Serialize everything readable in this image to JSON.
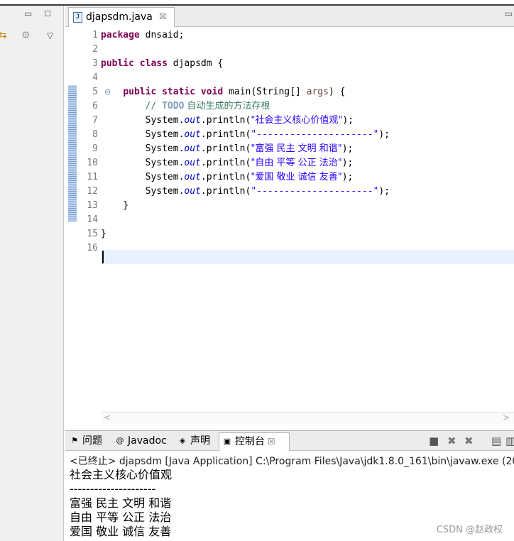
{
  "editor": {
    "tab_label": "djapsdm.java",
    "lines": [
      {
        "n": "1",
        "segs": [
          {
            "c": "kw",
            "t": "package"
          },
          {
            "c": "",
            "t": " dnsaid;"
          }
        ]
      },
      {
        "n": "2",
        "segs": []
      },
      {
        "n": "3",
        "segs": [
          {
            "c": "kw",
            "t": "public"
          },
          {
            "c": "",
            "t": " "
          },
          {
            "c": "kw",
            "t": "class"
          },
          {
            "c": "",
            "t": " djapsdm {"
          }
        ]
      },
      {
        "n": "4",
        "segs": []
      },
      {
        "n": "5",
        "segs": [
          {
            "c": "",
            "t": "    "
          },
          {
            "c": "kw",
            "t": "public"
          },
          {
            "c": "",
            "t": " "
          },
          {
            "c": "kw",
            "t": "static"
          },
          {
            "c": "",
            "t": " "
          },
          {
            "c": "kw",
            "t": "void"
          },
          {
            "c": "",
            "t": " main(String[] "
          },
          {
            "c": "param",
            "t": "args"
          },
          {
            "c": "",
            "t": ") {"
          }
        ]
      },
      {
        "n": "6",
        "segs": [
          {
            "c": "",
            "t": "        "
          },
          {
            "c": "cm",
            "t": "// "
          },
          {
            "c": "todo",
            "t": "TODO"
          },
          {
            "c": "cm cjk",
            "t": " 自动生成的方法存根"
          }
        ]
      },
      {
        "n": "7",
        "segs": [
          {
            "c": "",
            "t": "        System."
          },
          {
            "c": "fld",
            "t": "out"
          },
          {
            "c": "",
            "t": ".println("
          },
          {
            "c": "str cjk",
            "t": "\"社会主义核心价值观\""
          },
          {
            "c": "",
            "t": ");"
          }
        ]
      },
      {
        "n": "8",
        "segs": [
          {
            "c": "",
            "t": "        System."
          },
          {
            "c": "fld",
            "t": "out"
          },
          {
            "c": "",
            "t": ".println("
          },
          {
            "c": "str",
            "t": "\"---------------------\""
          },
          {
            "c": "",
            "t": ");"
          }
        ]
      },
      {
        "n": "9",
        "segs": [
          {
            "c": "",
            "t": "        System."
          },
          {
            "c": "fld",
            "t": "out"
          },
          {
            "c": "",
            "t": ".println("
          },
          {
            "c": "str cjk",
            "t": "\"富强 民主 文明 和谐\""
          },
          {
            "c": "",
            "t": ");"
          }
        ]
      },
      {
        "n": "10",
        "segs": [
          {
            "c": "",
            "t": "        System."
          },
          {
            "c": "fld",
            "t": "out"
          },
          {
            "c": "",
            "t": ".println("
          },
          {
            "c": "str cjk",
            "t": "\"自由 平等 公正 法治\""
          },
          {
            "c": "",
            "t": ");"
          }
        ]
      },
      {
        "n": "11",
        "segs": [
          {
            "c": "",
            "t": "        System."
          },
          {
            "c": "fld",
            "t": "out"
          },
          {
            "c": "",
            "t": ".println("
          },
          {
            "c": "str cjk",
            "t": "\"爱国 敬业 诚信 友善\""
          },
          {
            "c": "",
            "t": ");"
          }
        ]
      },
      {
        "n": "12",
        "segs": [
          {
            "c": "",
            "t": "        System."
          },
          {
            "c": "fld",
            "t": "out"
          },
          {
            "c": "",
            "t": ".println("
          },
          {
            "c": "str",
            "t": "\"---------------------\""
          },
          {
            "c": "",
            "t": ");"
          }
        ]
      },
      {
        "n": "13",
        "segs": [
          {
            "c": "",
            "t": "    }"
          }
        ]
      },
      {
        "n": "14",
        "segs": []
      },
      {
        "n": "15",
        "segs": [
          {
            "c": "",
            "t": "}"
          }
        ]
      },
      {
        "n": "16",
        "segs": []
      }
    ]
  },
  "panel": {
    "tabs": [
      {
        "label": "问题",
        "icon": "problems-icon",
        "active": false
      },
      {
        "label": "Javadoc",
        "icon": "at-icon",
        "active": false
      },
      {
        "label": "声明",
        "icon": "declaration-icon",
        "active": false
      },
      {
        "label": "控制台",
        "icon": "console-icon",
        "active": true
      }
    ],
    "terminated_line": "<已终止> djapsdm [Java Application] C:\\Program Files\\Java\\jdk1.8.0_161\\bin\\javaw.exe  (20",
    "output": [
      "社会主义核心价值观",
      "---------------------",
      "富强 民主 文明 和谐",
      "自由 平等 公正 法治",
      "爱国 敬业 诚信 友善"
    ]
  },
  "watermark": "CSDN @赵政权"
}
